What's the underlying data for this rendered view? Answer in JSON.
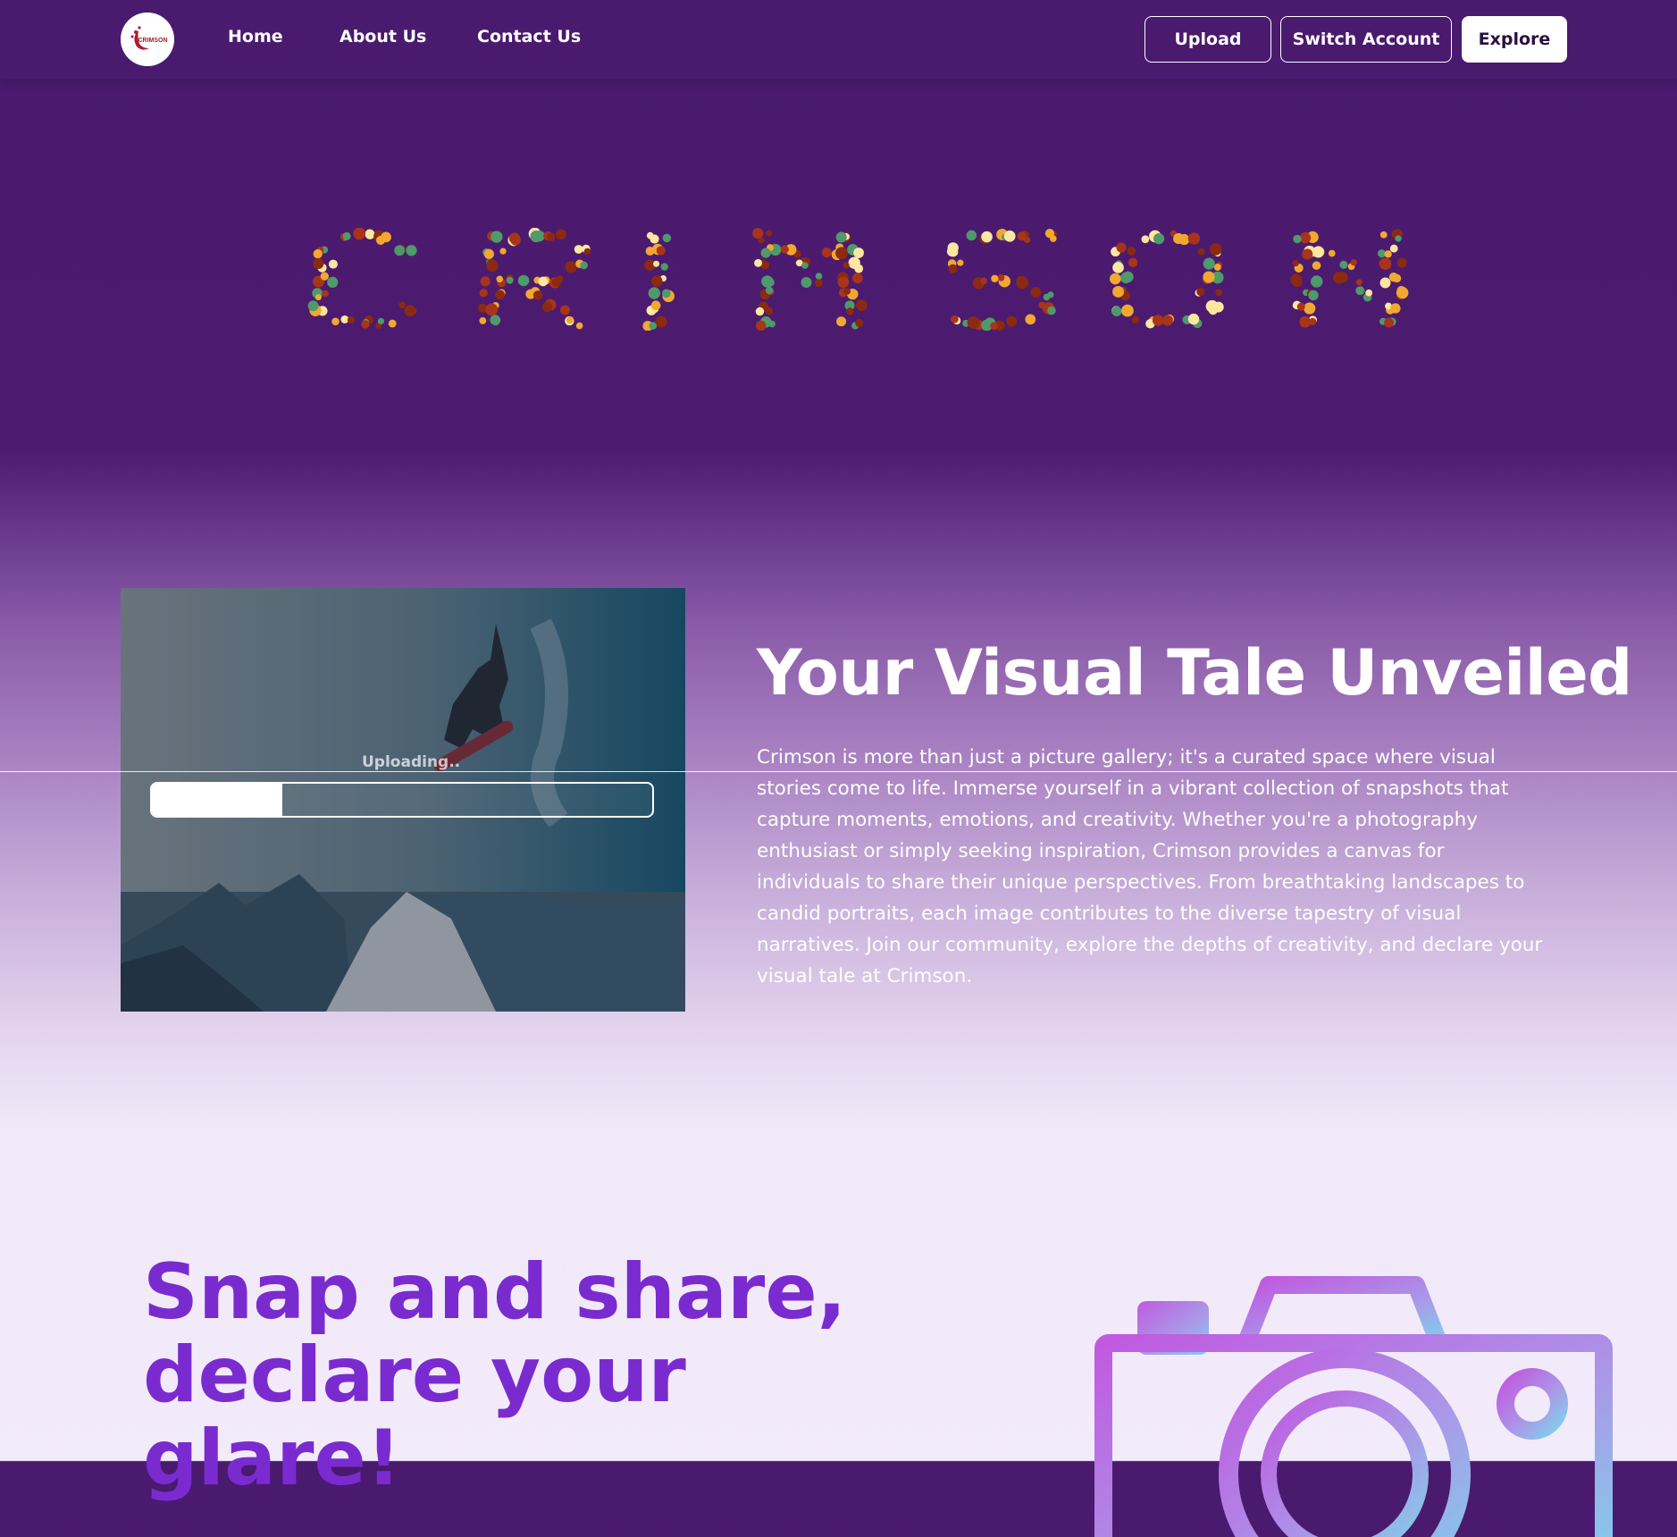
{
  "nav": {
    "logo_text": "CRIMSON",
    "links": [
      "Home",
      "About Us",
      "Contact Us"
    ],
    "buttons": {
      "upload": "Upload",
      "switch_account": "Switch Account",
      "explore": "Explore"
    }
  },
  "hero": {
    "word": "CRIMSON"
  },
  "upload_panel": {
    "status": "Uploading..",
    "progress": 0.26
  },
  "about": {
    "headline": "Your Visual Tale Unveiled",
    "description": "Crimson is more than just a picture gallery; it's a curated space where visual stories come to life. Immerse yourself in a vibrant collection of snapshots that capture moments, emotions, and creativity. Whether you're a photography enthusiast or simply seeking inspiration, Crimson provides a canvas for individuals to share their unique perspectives. From breathtaking landscapes to candid portraits, each image contributes to the diverse tapestry of visual narratives. Join our community, explore the depths of creativity, and declare your visual tale at Crimson."
  },
  "promo": {
    "tagline": "Snap and share, declare your glare!",
    "icon": "camera-icon"
  },
  "colors": {
    "nav_bg": "#4a1a6e",
    "tagline": "#7a2bd0",
    "dot_colors": [
      "#8b2a10",
      "#f0a830",
      "#fbe7a0",
      "#4e9a6a",
      "#a8341a"
    ]
  }
}
